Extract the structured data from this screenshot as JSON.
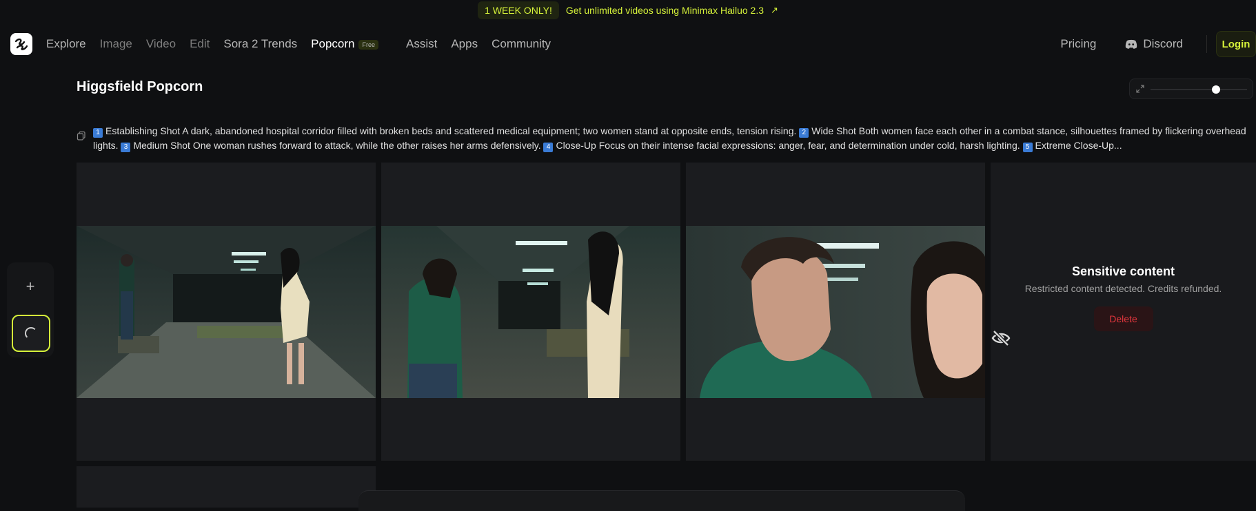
{
  "promo": {
    "pill": "1 WEEK ONLY!",
    "text": "Get unlimited videos using Minimax Hailuo 2.3",
    "arrow": "↗"
  },
  "nav": {
    "links": [
      {
        "label": "Explore"
      },
      {
        "label": "Image"
      },
      {
        "label": "Video"
      },
      {
        "label": "Edit"
      },
      {
        "label": "Sora 2 Trends"
      },
      {
        "label": "Popcorn",
        "badge": "Free"
      },
      {
        "label": "Assist"
      },
      {
        "label": "Apps"
      },
      {
        "label": "Community"
      }
    ],
    "pricing": "Pricing",
    "discord": "Discord",
    "login": "Login"
  },
  "page": {
    "title": "Higgsfield Popcorn"
  },
  "prompt": {
    "parts": [
      {
        "num": "1",
        "text": "Establishing Shot A dark, abandoned hospital corridor filled with broken beds and scattered medical equipment; two women stand at opposite ends, tension rising."
      },
      {
        "num": "2",
        "text": "Wide Shot Both women face each other in a combat stance, silhouettes framed by flickering overhead lights."
      },
      {
        "num": "3",
        "text": "Medium Shot One woman rushes forward to attack, while the other raises her arms defensively."
      },
      {
        "num": "4",
        "text": "Close-Up Focus on their intense facial expressions: anger, fear, and determination under cold, harsh lighting."
      },
      {
        "num": "5",
        "text": "Extreme Close-Up..."
      }
    ]
  },
  "sensitive": {
    "title": "Sensitive content",
    "message": "Restricted content detected. Credits refunded.",
    "delete": "Delete"
  },
  "sidebar": {
    "add": "+"
  },
  "colors": {
    "accent": "#d6f23a",
    "danger": "#e2363d",
    "bg": "#0f1012"
  },
  "icons": [
    "logo-icon",
    "external-arrow-icon",
    "discord-icon",
    "expand-icon",
    "copy-icon",
    "plus-icon",
    "spinner-icon",
    "eye-off-icon"
  ]
}
